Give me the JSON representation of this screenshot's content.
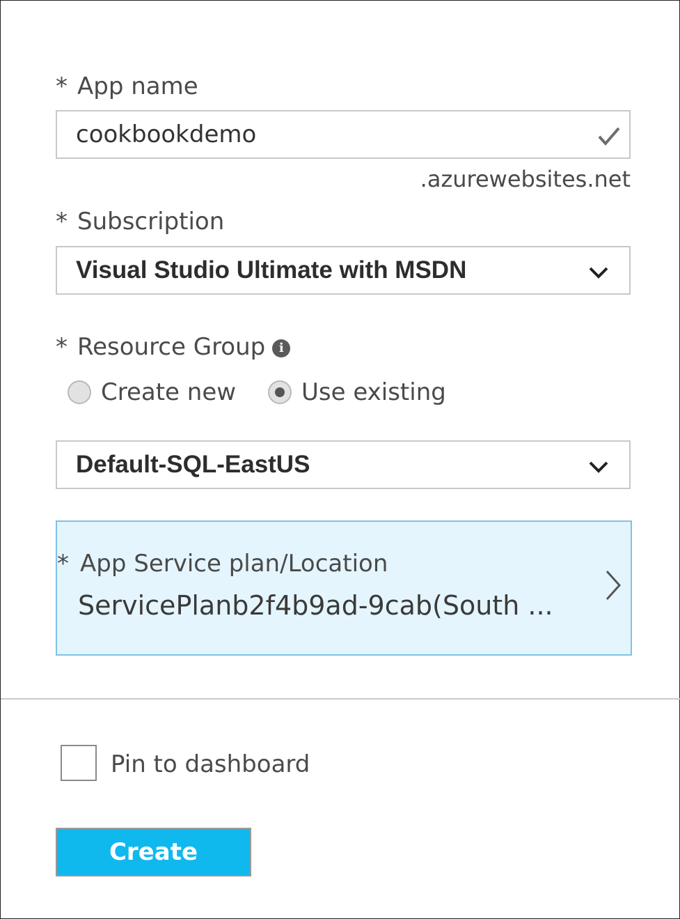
{
  "app_name": {
    "asterisk": "*",
    "label": "App name",
    "value": "cookbookdemo",
    "suffix": ".azurewebsites.net",
    "valid_icon": "checkmark-icon"
  },
  "subscription": {
    "asterisk": "*",
    "label": "Subscription",
    "selected": "Visual Studio Ultimate with MSDN"
  },
  "resource_group": {
    "asterisk": "*",
    "label": "Resource Group",
    "info_icon": "i",
    "options": [
      {
        "label": "Create new",
        "checked": false
      },
      {
        "label": "Use existing",
        "checked": true
      }
    ],
    "selected": "Default-SQL-EastUS"
  },
  "service_plan": {
    "asterisk": "*",
    "label": "App Service plan/Location",
    "value": "ServicePlanb2f4b9ad-9cab(South ..."
  },
  "pin": {
    "label": "Pin to dashboard",
    "checked": false
  },
  "create_label": "Create",
  "colors": {
    "accent": "#0fb9ee",
    "plan_bg": "#e5f5fd",
    "plan_border": "#7fc2e8"
  }
}
